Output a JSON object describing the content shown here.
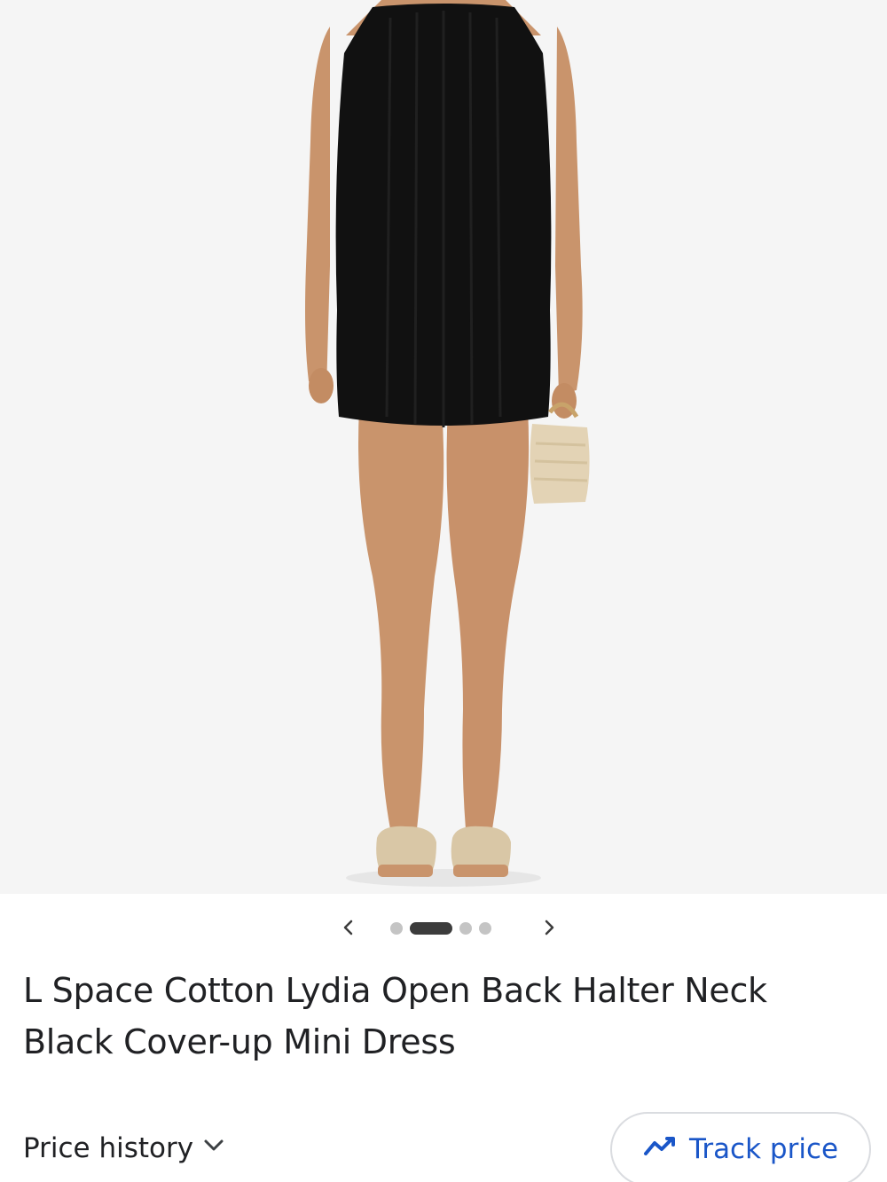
{
  "product": {
    "image_alt": "Model wearing black halter neck mini dress with woven handbag and sandals",
    "title": "L Space Cotton Lydia Open Back Halter Neck Black Cover-up Mini Dress"
  },
  "carousel": {
    "prev_icon": "chevron-left-icon",
    "next_icon": "chevron-right-icon",
    "dot_count": 4,
    "active_index": 1
  },
  "actions": {
    "price_history_label": "Price history",
    "track_price_label": "Track price"
  },
  "colors": {
    "image_bg": "#f5f5f5",
    "dress": "#111111",
    "skin": "#c9946c",
    "accent": "#1a56c8",
    "text": "#202124"
  }
}
